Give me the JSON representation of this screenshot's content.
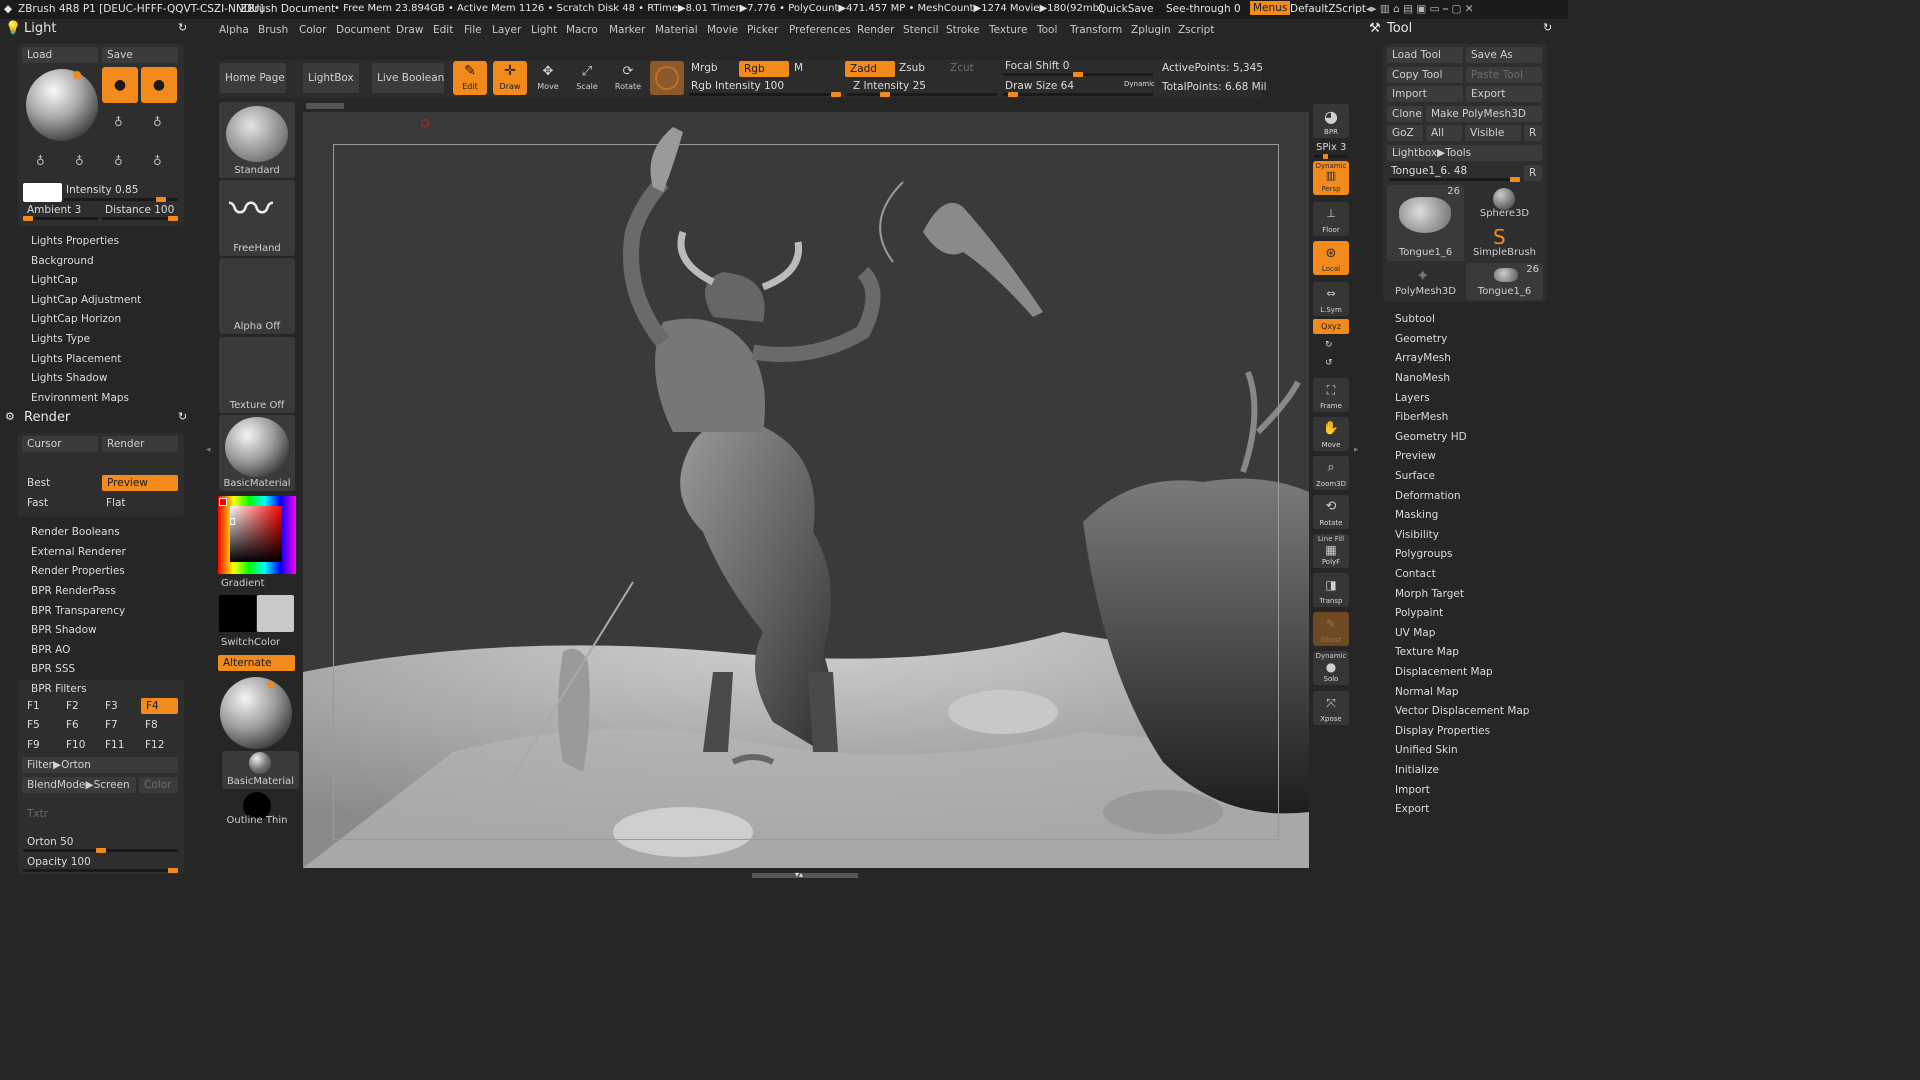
{
  "titlebar": {
    "app": "ZBrush 4R8 P1 [DEUC-HFFF-QQVT-CSZI-NNDU]",
    "doc": "ZBrush Document",
    "stats": "• Free Mem 23.894GB • Active Mem 1126 • Scratch Disk 48 • RTime▶8.01 Timer▶7.776 • PolyCount▶471.457 MP • MeshCount▶1274 Movie▶180(92mb)",
    "quicksave": "QuickSave",
    "seethrough": "See-through 0",
    "menus": "Menus",
    "script": "DefaultZScript"
  },
  "menubar": [
    "Alpha",
    "Brush",
    "Color",
    "Document",
    "Draw",
    "Edit",
    "File",
    "Layer",
    "Light",
    "Macro",
    "Marker",
    "Material",
    "Movie",
    "Picker",
    "Preferences",
    "Render",
    "Stencil",
    "Stroke",
    "Texture",
    "Tool",
    "Transform",
    "Zplugin",
    "Zscript"
  ],
  "top_shelf": {
    "home": "Home Page",
    "lightbox": "LightBox",
    "live_boolean": "Live Boolean",
    "edit": "Edit",
    "draw": "Draw",
    "move": "Move",
    "scale": "Scale",
    "rotate": "Rotate",
    "mrgb": "Mrgb",
    "rgb": "Rgb",
    "m": "M",
    "zadd": "Zadd",
    "zsub": "Zsub",
    "zcut": "Zcut",
    "rgb_intensity": "Rgb Intensity 100",
    "z_intensity": "Z Intensity 25",
    "focal_shift": "Focal Shift 0",
    "draw_size": "Draw Size 64",
    "dynamic": "Dynamic",
    "active_points": "ActivePoints: 5,345",
    "total_points": "TotalPoints: 6.68 Mil",
    "rgb_intensity_value": 100,
    "z_intensity_value": 25,
    "focal_shift_value": 0,
    "draw_size_value": 64
  },
  "light_panel": {
    "title": "Light",
    "load": "Load",
    "save": "Save",
    "intensity": "Intensity 0.85",
    "ambient": "Ambient 3",
    "distance": "Distance 100",
    "intensity_value": 0.85,
    "ambient_value": 3,
    "distance_value": 100,
    "items": [
      "Lights Properties",
      "Background",
      "LightCap",
      "LightCap Adjustment",
      "LightCap Horizon",
      "Lights Type",
      "Lights Placement",
      "Lights Shadow",
      "Environment Maps"
    ]
  },
  "render_panel": {
    "title": "Render",
    "cursor": "Cursor",
    "render": "Render",
    "best": "Best",
    "preview": "Preview",
    "fast": "Fast",
    "flat": "Flat",
    "items": [
      "Render Booleans",
      "External Renderer",
      "Render Properties",
      "BPR RenderPass",
      "BPR Transparency",
      "BPR Shadow",
      "BPR AO",
      "BPR SSS"
    ],
    "bpr_filters": "BPR Filters",
    "filters": [
      "F1",
      "F2",
      "F3",
      "F4",
      "F5",
      "F6",
      "F7",
      "F8",
      "F9",
      "F10",
      "F11",
      "F12"
    ],
    "filter_orton": "Filter▶Orton",
    "blend_mode": "BlendMode▶Screen",
    "color": "Color",
    "txtr": "Txtr",
    "orton": "Orton 50",
    "opacity": "Opacity 100",
    "orton_value": 50,
    "opacity_value": 100
  },
  "left_shelf": {
    "standard": "Standard",
    "freehand": "FreeHand",
    "alpha_off": "Alpha Off",
    "texture_off": "Texture Off",
    "basic_material": "BasicMaterial",
    "gradient": "Gradient",
    "switchcolor": "SwitchColor",
    "alternate": "Alternate",
    "basic_material2": "BasicMaterial",
    "outline_thin": "Outline Thin"
  },
  "right_shelf": {
    "bpr": "BPR",
    "spix": "SPix 3",
    "dynamic": "Dynamic",
    "persp": "Persp",
    "floor": "Floor",
    "local": "Local",
    "lsym": "L.Sym",
    "xyz": "Qxyz",
    "frame": "Frame",
    "move": "Move",
    "zoom3d": "Zoom3D",
    "rotate": "Rotate",
    "linefill": "Line Fill",
    "polyf": "PolyF",
    "transp": "Transp",
    "ghost": "Ghost",
    "dynamic2": "Dynamic",
    "solo": "Solo",
    "xpose": "Xpose"
  },
  "tool_panel": {
    "title": "Tool",
    "load_tool": "Load Tool",
    "save_as": "Save As",
    "copy_tool": "Copy Tool",
    "paste_tool": "Paste Tool",
    "import": "Import",
    "export": "Export",
    "clone": "Clone",
    "make_polymesh": "Make PolyMesh3D",
    "goz": "GoZ",
    "all": "All",
    "visible": "Visible",
    "r": "R",
    "lightbox_tools": "Lightbox▶Tools",
    "tongue": "Tongue1_6. 48",
    "tongue_value": 48,
    "thumbs": [
      {
        "label": "Tongue1_6",
        "count": "26"
      },
      {
        "label": "Sphere3D",
        "count": ""
      },
      {
        "label": "SimpleBrush",
        "count": ""
      },
      {
        "label": "PolyMesh3D",
        "count": ""
      },
      {
        "label": "Tongue1_6",
        "count": "26"
      }
    ],
    "items": [
      "Subtool",
      "Geometry",
      "ArrayMesh",
      "NanoMesh",
      "Layers",
      "FiberMesh",
      "Geometry HD",
      "Preview",
      "Surface",
      "Deformation",
      "Masking",
      "Visibility",
      "Polygroups",
      "Contact",
      "Morph Target",
      "Polypaint",
      "UV Map",
      "Texture Map",
      "Displacement Map",
      "Normal Map",
      "Vector Displacement Map",
      "Display Properties",
      "Unified Skin",
      "Initialize",
      "Import",
      "Export"
    ]
  },
  "colors": {
    "accent": "#f28b1c",
    "bg": "#262626",
    "panel": "#2e2e2e",
    "canvas": "#3a3a3a"
  }
}
